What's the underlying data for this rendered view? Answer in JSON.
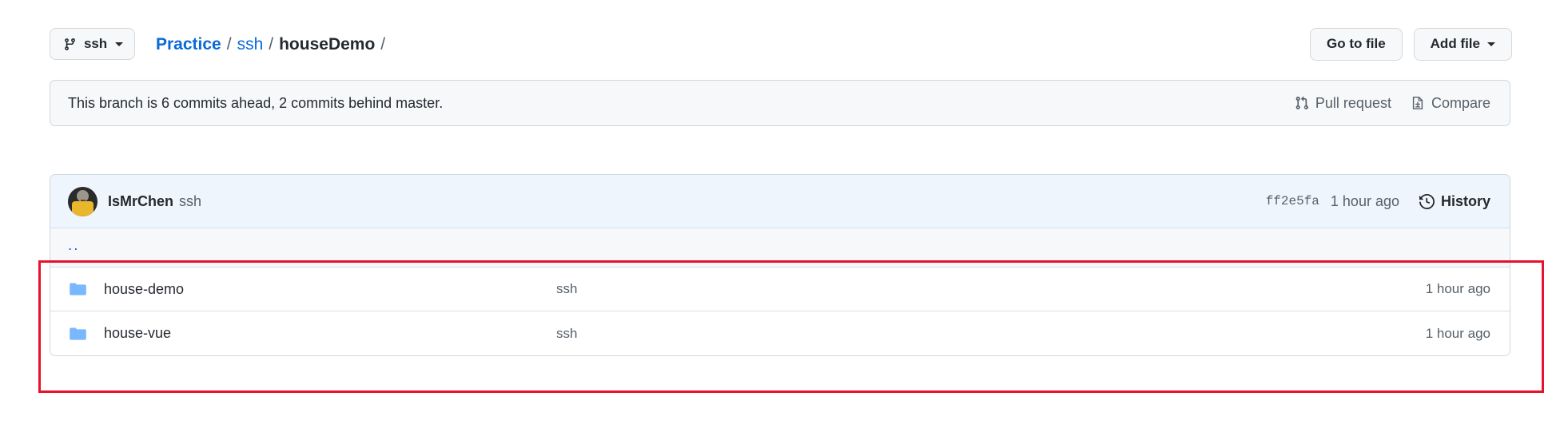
{
  "header": {
    "branch_selector": {
      "icon": "git-branch-icon",
      "name": "ssh",
      "caret": "chevron-down-icon"
    },
    "breadcrumb": {
      "repo": "Practice",
      "sep1": "/",
      "path1": "ssh",
      "sep2": "/",
      "current": "houseDemo",
      "sep3": "/"
    },
    "actions": {
      "go_to_file": "Go to file",
      "add_file": "Add file"
    }
  },
  "branch_notice": {
    "text": "This branch is 6 commits ahead, 2 commits behind master.",
    "pull_request": "Pull request",
    "compare": "Compare"
  },
  "latest_commit": {
    "author": "IsMrChen",
    "message": "ssh",
    "sha": "ff2e5fa",
    "time": "1 hour ago",
    "history": "History"
  },
  "file_list": {
    "parent": "..",
    "rows": [
      {
        "icon": "folder-icon",
        "name": "house-demo",
        "message": "ssh",
        "time": "1 hour ago"
      },
      {
        "icon": "folder-icon",
        "name": "house-vue",
        "message": "ssh",
        "time": "1 hour ago"
      }
    ]
  },
  "colors": {
    "link": "#0969da",
    "folder": "#79b8ff",
    "annotation": "#e8112d",
    "commit_row_bg": "#eff5fd"
  }
}
